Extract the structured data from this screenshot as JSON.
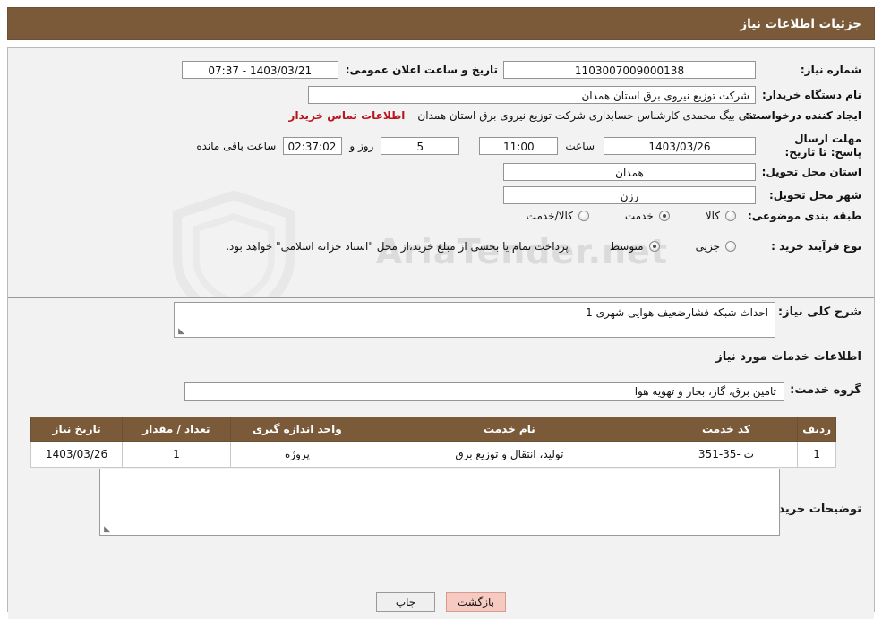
{
  "header": {
    "title": "جزئیات اطلاعات نیاز"
  },
  "form": {
    "need_number_label": "شماره نیاز:",
    "need_number_value": "1103007009000138",
    "announce_datetime_label": "تاریخ و ساعت اعلان عمومی:",
    "announce_datetime_value": "1403/03/21 - 07:37",
    "buyer_org_label": "نام دستگاه خریدار:",
    "buyer_org_value": "شرکت توزیع نیروی برق استان همدان",
    "creator_label": "ایجاد کننده درخواست:",
    "creator_value": "تقی بیگ محمدی کارشناس حسابداری شرکت توزیع نیروی برق استان همدان",
    "contact_link": "اطلاعات تماس خریدار",
    "deadline_label": "مهلت ارسال پاسخ: تا تاریخ:",
    "deadline_date": "1403/03/26",
    "hour_label": "ساعت",
    "deadline_time": "11:00",
    "days_value": "5",
    "days_label": "روز و",
    "countdown_value": "02:37:02",
    "countdown_label": "ساعت باقی مانده",
    "province_label": "استان محل تحویل:",
    "province_value": "همدان",
    "city_label": "شهر محل تحویل:",
    "city_value": "رزن",
    "category_label": "طبقه بندی موضوعی:",
    "category_options": [
      {
        "label": "کالا",
        "selected": false
      },
      {
        "label": "خدمت",
        "selected": true
      },
      {
        "label": "کالا/خدمت",
        "selected": false
      }
    ],
    "process_label": "نوع فرآیند خرید :",
    "process_options": [
      {
        "label": "جزیی",
        "selected": false
      },
      {
        "label": "متوسط",
        "selected": true
      }
    ],
    "process_note": "پرداخت تمام یا بخشی از مبلغ خرید،از محل \"اسناد خزانه اسلامی\" خواهد بود."
  },
  "details": {
    "general_desc_label": "شرح کلی نیاز:",
    "general_desc_value": "احداث شبکه فشارضعیف هوایی شهری 1",
    "services_info_heading": "اطلاعات خدمات مورد نیاز",
    "service_group_label": "گروه خدمت:",
    "service_group_value": "تامین برق، گاز، بخار و تهویه هوا",
    "table": {
      "headers": [
        "ردیف",
        "کد خدمت",
        "نام خدمت",
        "واحد اندازه گیری",
        "تعداد / مقدار",
        "تاریخ نیاز"
      ],
      "rows": [
        [
          "1",
          "ت -35-351",
          "تولید، انتقال و توزیع برق",
          "پروژه",
          "1",
          "1403/03/26"
        ]
      ]
    },
    "buyer_notes_label": "توضیحات خریدار:",
    "buyer_notes_value": ""
  },
  "footer": {
    "print_button": "چاپ",
    "back_button": "بازگشت"
  },
  "watermark": {
    "text": "AriaTender.net"
  },
  "colors": {
    "header_brown": "#7b5a3a",
    "link_red": "#b8161e",
    "back_button": "#f6c9c1"
  }
}
